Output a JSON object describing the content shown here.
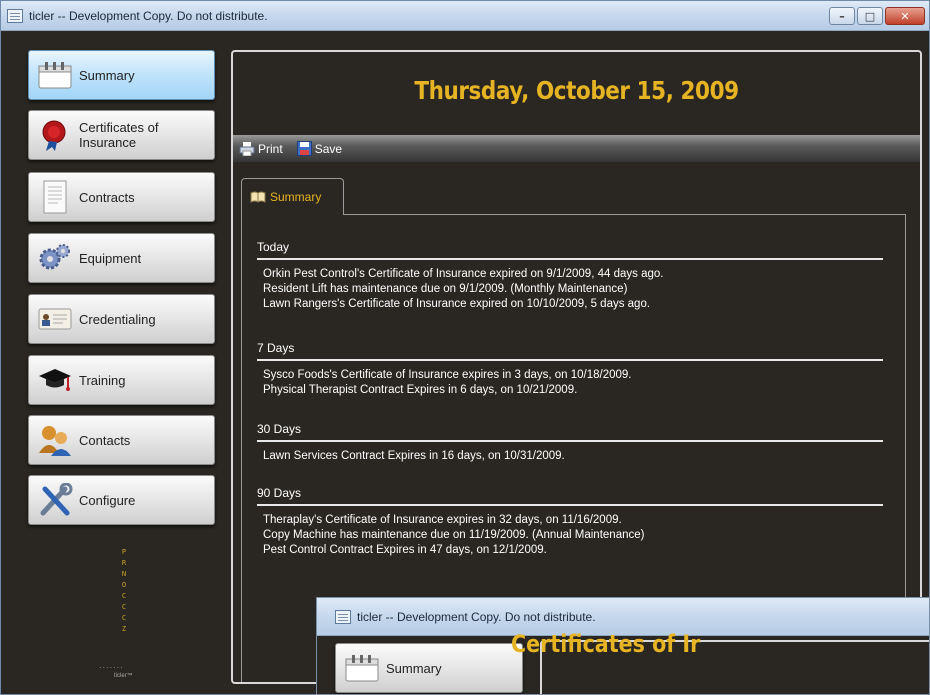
{
  "window": {
    "title": "ticler -- Development Copy.  Do not distribute.",
    "controls": {
      "minimize": "–",
      "maximize": "□",
      "close": "✕"
    }
  },
  "sidebar": {
    "items": [
      {
        "id": "summary",
        "label": "Summary",
        "icon": "calendar-icon",
        "active": true
      },
      {
        "id": "coi",
        "label": "Certificates of Insurance",
        "icon": "wax-seal-icon"
      },
      {
        "id": "contracts",
        "label": "Contracts",
        "icon": "document-icon"
      },
      {
        "id": "equipment",
        "label": "Equipment",
        "icon": "gears-icon"
      },
      {
        "id": "credentialing",
        "label": "Credentialing",
        "icon": "id-card-icon"
      },
      {
        "id": "training",
        "label": "Training",
        "icon": "graduation-cap-icon"
      },
      {
        "id": "contacts",
        "label": "Contacts",
        "icon": "people-icon"
      },
      {
        "id": "configure",
        "label": "Configure",
        "icon": "tools-icon"
      }
    ],
    "vertical_logo": [
      "P",
      "R",
      "N",
      "O",
      "C",
      "C",
      "C",
      "Z"
    ],
    "dots": ".......",
    "mini_brand": "ticler™"
  },
  "main": {
    "date_title": "Thursday, October 15, 2009",
    "toolbar": {
      "print_label": "Print",
      "save_label": "Save"
    },
    "tab_label": "Summary",
    "sections": [
      {
        "heading": "Today",
        "items": [
          "Orkin Pest Control's Certificate of Insurance expired on 9/1/2009, 44 days ago.",
          "Resident Lift has maintenance due on 9/1/2009. (Monthly Maintenance)",
          "Lawn Rangers's Certificate of Insurance expired on 10/10/2009, 5 days ago."
        ]
      },
      {
        "heading": "7 Days",
        "items": [
          "Sysco Foods's Certificate of Insurance expires in 3 days, on 10/18/2009.",
          "Physical Therapist Contract Expires in 6 days, on 10/21/2009."
        ]
      },
      {
        "heading": "30 Days",
        "items": [
          "Lawn Services Contract Expires in 16 days, on 10/31/2009."
        ]
      },
      {
        "heading": "90 Days",
        "items": [
          "Theraplay's Certificate of Insurance expires in 32 days, on 11/16/2009.",
          "Copy Machine has maintenance due on 11/19/2009. (Annual Maintenance)",
          "Pest Control Contract Expires in 47 days, on 12/1/2009."
        ]
      }
    ]
  },
  "second_window": {
    "title": "ticler -- Development Copy.  Do not distribute.",
    "nav_label": "Summary",
    "content_title": "Certificates of Ir"
  },
  "colors": {
    "accent": "#e6b422",
    "background": "#2a2722",
    "titlebar": "#c3d6ec"
  }
}
